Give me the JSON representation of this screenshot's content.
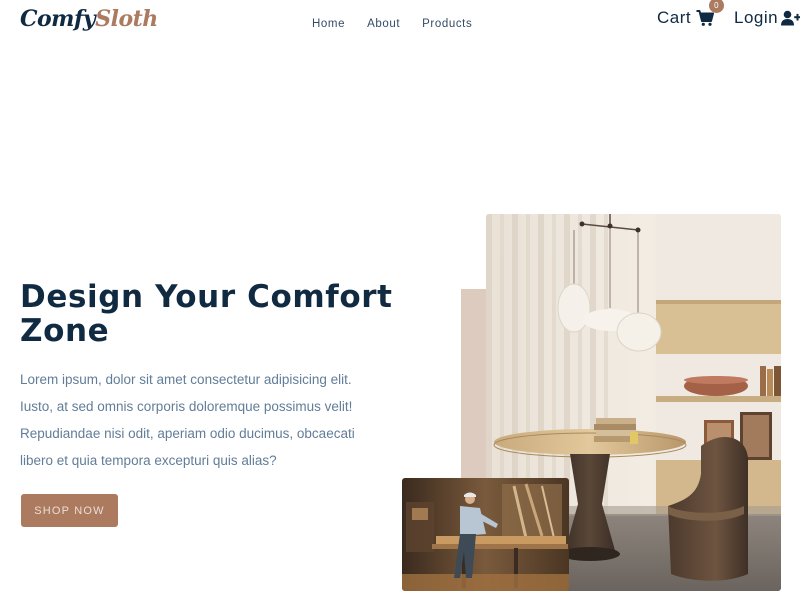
{
  "brand": {
    "part1": "Comfy",
    "part2": "Sloth"
  },
  "nav": {
    "links": [
      "Home",
      "About",
      "Products"
    ]
  },
  "cart": {
    "label": "Cart",
    "count": "0"
  },
  "login": {
    "label": "Login"
  },
  "hero": {
    "title": "Design Your Comfort Zone",
    "text": "Lorem ipsum, dolor sit amet consectetur adipisicing elit. Iusto, at sed omnis corporis doloremque possimus velit! Repudiandae nisi odit, aperiam odio ducimus, obcaecati libero et quia tempora excepturi quis alias?",
    "cta": "SHOP NOW"
  },
  "colors": {
    "primary": "#ab7a5f",
    "heading": "#102a42",
    "body_text": "#617d98",
    "accent_block": "#decbc0"
  },
  "icons": {
    "cart": "shopping-cart-icon",
    "login": "user-plus-icon"
  }
}
